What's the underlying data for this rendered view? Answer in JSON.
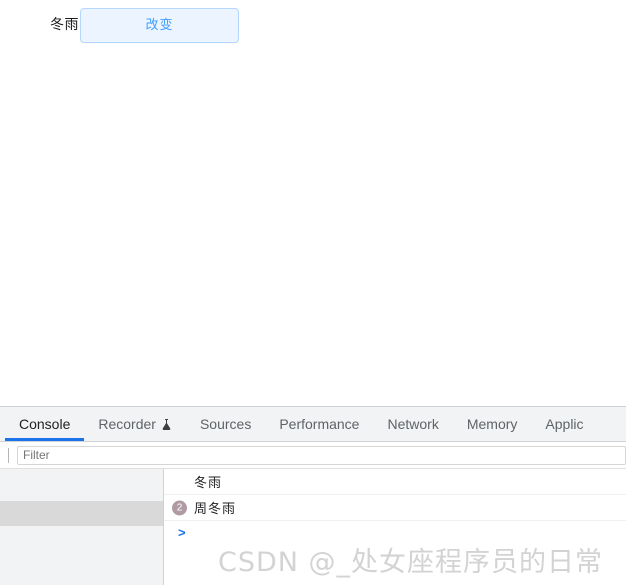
{
  "page": {
    "label_text": "冬雨",
    "change_button_label": "改变",
    "button_accent": "#409eff",
    "button_bg": "#ecf5ff",
    "button_border": "#b3d8ff"
  },
  "devtools": {
    "accent": "#1a73e8",
    "tabs": [
      {
        "label": "Console",
        "active": true,
        "icon": ""
      },
      {
        "label": "Recorder",
        "active": false,
        "icon": "flask-icon"
      },
      {
        "label": "Sources",
        "active": false,
        "icon": ""
      },
      {
        "label": "Performance",
        "active": false,
        "icon": ""
      },
      {
        "label": "Network",
        "active": false,
        "icon": ""
      },
      {
        "label": "Memory",
        "active": false,
        "icon": ""
      },
      {
        "label": "Applic",
        "active": false,
        "icon": ""
      }
    ],
    "toolbar": {
      "filter_placeholder": "Filter",
      "filter_value": ""
    },
    "console": {
      "messages": [
        {
          "badge": "",
          "text": "冬雨"
        },
        {
          "badge": "2",
          "text": "周冬雨"
        }
      ],
      "prompt_symbol": ">",
      "prompt_value": "",
      "badge_color": "#b09aa4"
    }
  },
  "watermark": {
    "text": "CSDN @_处女座程序员的日常"
  }
}
